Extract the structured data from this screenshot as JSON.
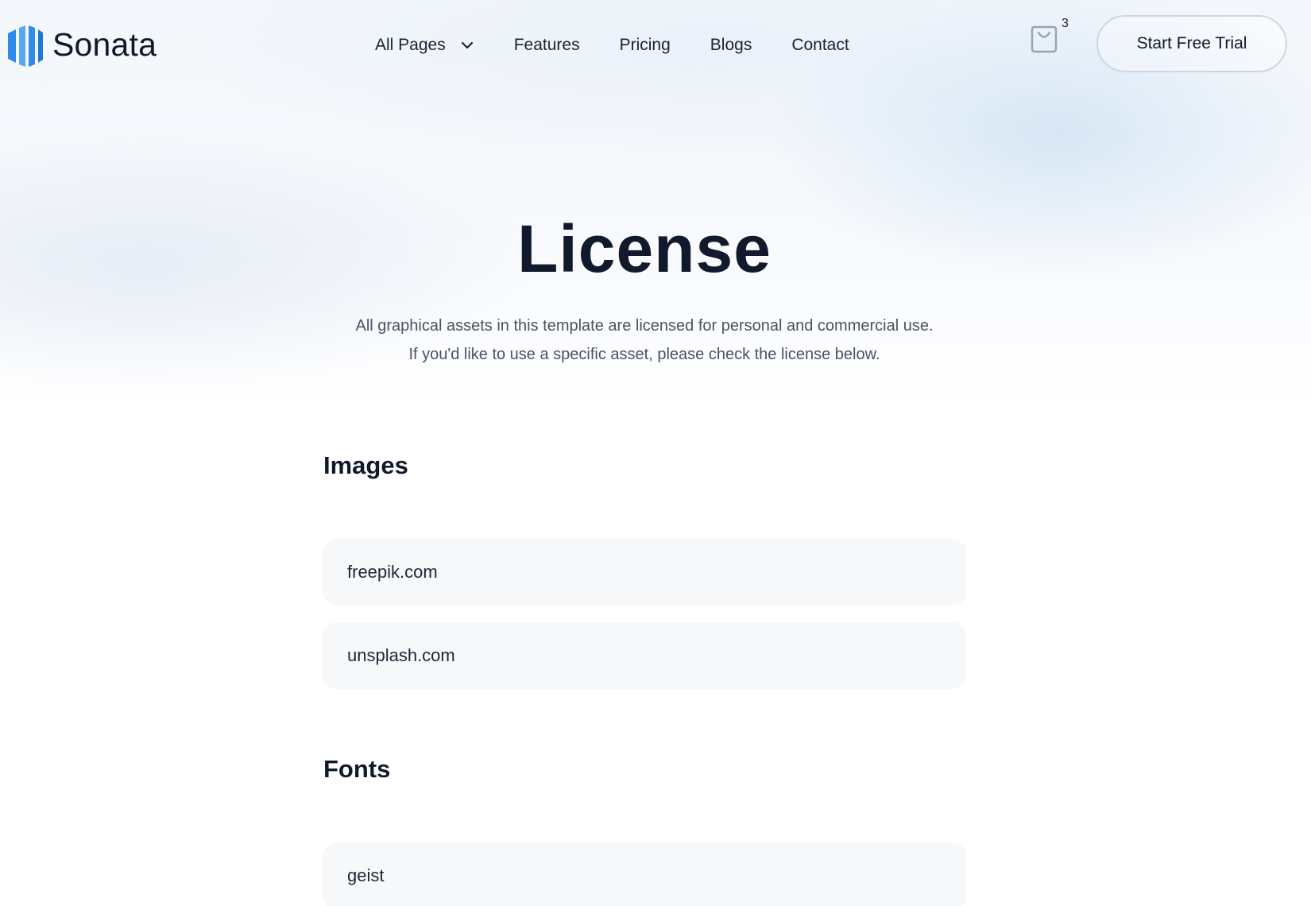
{
  "brand": {
    "name": "Sonata",
    "logo_icon": "sonata-logo-icon",
    "accent": "#2f8cea"
  },
  "nav": {
    "items": [
      {
        "label": "All Pages",
        "has_dropdown": true
      },
      {
        "label": "Features"
      },
      {
        "label": "Pricing"
      },
      {
        "label": "Blogs"
      },
      {
        "label": "Contact"
      }
    ]
  },
  "cart": {
    "icon": "shopping-bag-icon",
    "count": "3"
  },
  "cta": {
    "label": "Start Free Trial"
  },
  "hero": {
    "title": "License",
    "subtitle_line1": "All graphical assets in this template are licensed for personal and commercial use.",
    "subtitle_line2": "If you'd like to use a specific asset, please check the license below."
  },
  "sections": [
    {
      "title": "Images",
      "items": [
        "freepik.com",
        "unsplash.com"
      ]
    },
    {
      "title": "Fonts",
      "items": [
        "geist"
      ]
    }
  ]
}
